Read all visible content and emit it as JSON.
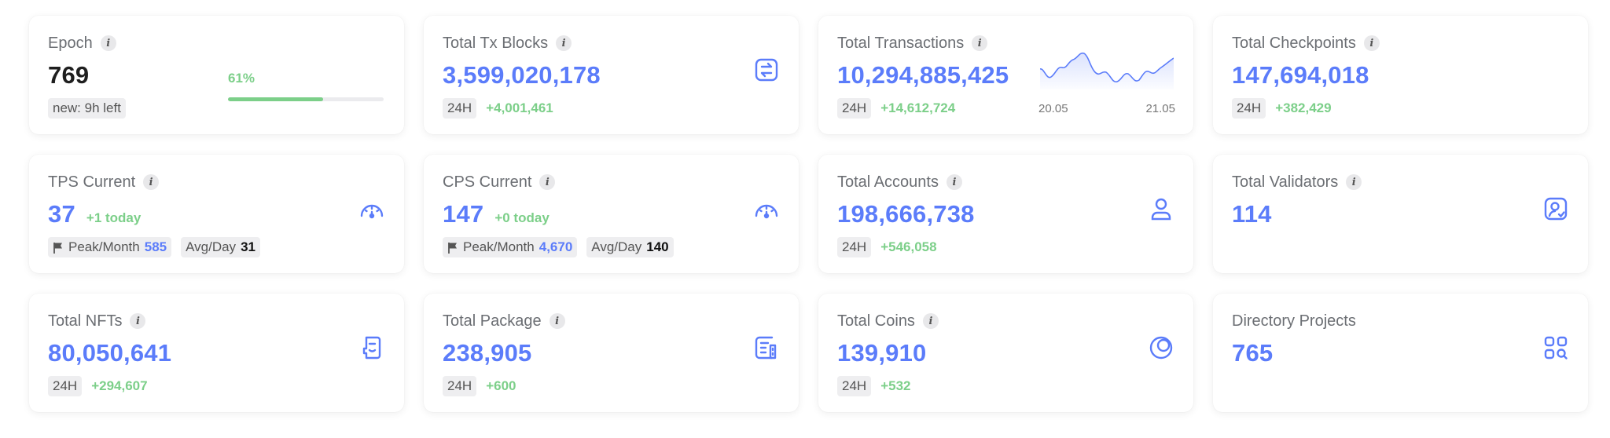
{
  "cards": {
    "epoch": {
      "title": "Epoch",
      "value": "769",
      "tag": "new: 9h left",
      "progress_label": "61%",
      "progress": 0.61
    },
    "tx_blocks": {
      "title": "Total Tx Blocks",
      "value": "3,599,020,178",
      "tag": "24H",
      "delta": "+4,001,461"
    },
    "transactions": {
      "title": "Total Transactions",
      "value": "10,294,885,425",
      "tag": "24H",
      "delta": "+14,612,724",
      "spark_start": "20.05",
      "spark_end": "21.05"
    },
    "checkpoints": {
      "title": "Total Checkpoints",
      "value": "147,694,018",
      "tag": "24H",
      "delta": "+382,429"
    },
    "tps": {
      "title": "TPS Current",
      "value": "37",
      "today": "+1 today",
      "peak_label": "Peak/Month",
      "peak_value": "585",
      "avg_label": "Avg/Day",
      "avg_value": "31"
    },
    "cps": {
      "title": "CPS Current",
      "value": "147",
      "today": "+0 today",
      "peak_label": "Peak/Month",
      "peak_value": "4,670",
      "avg_label": "Avg/Day",
      "avg_value": "140"
    },
    "accounts": {
      "title": "Total Accounts",
      "value": "198,666,738",
      "tag": "24H",
      "delta": "+546,058"
    },
    "validators": {
      "title": "Total Validators",
      "value": "114"
    },
    "nfts": {
      "title": "Total NFTs",
      "value": "80,050,641",
      "tag": "24H",
      "delta": "+294,607"
    },
    "package": {
      "title": "Total Package",
      "value": "238,905",
      "tag": "24H",
      "delta": "+600"
    },
    "coins": {
      "title": "Total Coins",
      "value": "139,910",
      "tag": "24H",
      "delta": "+532"
    },
    "projects": {
      "title": "Directory Projects",
      "value": "765"
    }
  },
  "info_icon_glyph": "i",
  "colors": {
    "accent": "#5b7cfa",
    "positive": "#7ccf89",
    "progress_track": "#ebebee"
  },
  "icons": {
    "tx_blocks": "transfer-icon",
    "tps": "speedometer-icon",
    "cps": "speedometer-icon",
    "accounts": "user-icon",
    "validators": "validator-badge-icon",
    "nfts": "nft-icon",
    "package": "package-icon",
    "coins": "coins-icon",
    "projects": "apps-search-icon",
    "peak": "flag-icon"
  }
}
